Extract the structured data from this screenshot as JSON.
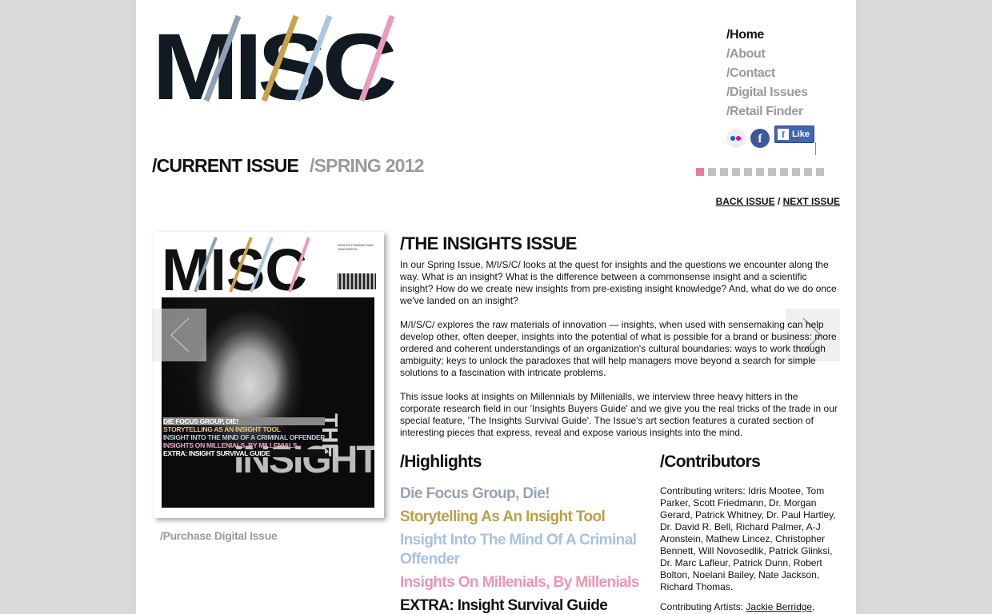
{
  "brand": {
    "logo_text": "MISC"
  },
  "nav": {
    "items": [
      {
        "label": "/Home",
        "active": true
      },
      {
        "label": "/About",
        "active": false
      },
      {
        "label": "/Contact",
        "active": false
      },
      {
        "label": "/Digital Issues",
        "active": false
      },
      {
        "label": "/Retail Finder",
        "active": false
      }
    ],
    "social": {
      "like_label": "Like"
    }
  },
  "pager": {
    "count": 11,
    "active_index": 0
  },
  "issue": {
    "label": "/CURRENT ISSUE",
    "season": "/SPRING 2012",
    "back_label": "BACK ISSUE",
    "separator": "/",
    "next_label": "NEXT ISSUE"
  },
  "cover": {
    "logo_text": "MISC",
    "side_text": "DESIGN THINKING AND INNOVATION",
    "big_title": "INSIGHT",
    "vertical_title": "THE",
    "list": [
      "DIE FOCUS GROUP, DIE!",
      "STORYTELLING AS AN INSIGHT TOOL",
      "INSIGHT INTO THE MIND OF A CRIMINAL OFFENDER",
      "INSIGHTS ON MILLENIALS, BY MILLENIALS",
      "EXTRA: INSIGHT SURVIVAL GUIDE"
    ]
  },
  "purchase_link": "/Purchase Digital Issue",
  "article": {
    "title": "/THE INSIGHTS ISSUE",
    "paragraphs": [
      "In our Spring Issue, M/I/S/C/ looks at the quest for insights and the questions we encounter along the way. What is an insight? What is the difference between a commonsense insight and a scientific insight? How do we create new insights from pre-existing insight knowledge? And, what do we do once we've landed on an insight?",
      "M/I/S/C/ explores the raw materials of innovation — insights, when used with sensemaking can help develop other, often deeper, insights into the potential of what is possible for a brand or business: more ordered and coherent understandings of an organization's cultural boundaries: ways to work through ambiguity; keys to unlock the paradoxes that will help managers move beyond a search for simple solutions to a fascination with intricate problems.",
      "This issue looks at insights on Millennials by Millenialls, we interview three heavy hitters in the corporate research field in our 'Insights Buyers Guide' and we give you the real tricks of the trade in our special feature, 'The Insights Survival Guide'. The Issue's art section features a curated section of interesting pieces that express, reveal and expose various insights into the mind."
    ]
  },
  "highlights": {
    "title": "/Highlights",
    "items": [
      {
        "label": "Die Focus Group, Die!",
        "color": "#9aa3ad"
      },
      {
        "label": "Storytelling As An Insight Tool",
        "color": "#b9a04a"
      },
      {
        "label": "Insight Into The Mind Of A Criminal Offender",
        "color": "#a9c2de"
      },
      {
        "label": "Insights On Millenials, By Millenials",
        "color": "#e996b6"
      },
      {
        "label": "EXTRA: Insight Survival Guide",
        "color": "#111111"
      }
    ]
  },
  "contributors": {
    "title": "/Contributors",
    "writers": "Contributing writers: Idris Mootee, Tom Parker, Scott Friedmann, Dr. Morgan Gerard, Patrick Whitney, Dr. Paul Hartley, Dr. David R. Bell, Richard Palmer, A-J Aronstein, Mathew Lincez, Christopher Bennett, Will Novosedlik, Patrick Glinksi, Dr. Marc Lafleur, Patrick Dunn, Robert Bolton, Noelani Bailey, Nate Jackson, Richard Thomas.",
    "artists_prefix": "Contributing Artists: ",
    "artists_first": "Jackie Berridge",
    "artists_suffix": ","
  },
  "colors": {
    "slash_grey": "#8ea0b3",
    "slash_gold": "#c8a24a",
    "slash_blue": "#a9c6e3",
    "slash_pink": "#ec9ab9",
    "accent_pink": "#ea7aa6"
  }
}
